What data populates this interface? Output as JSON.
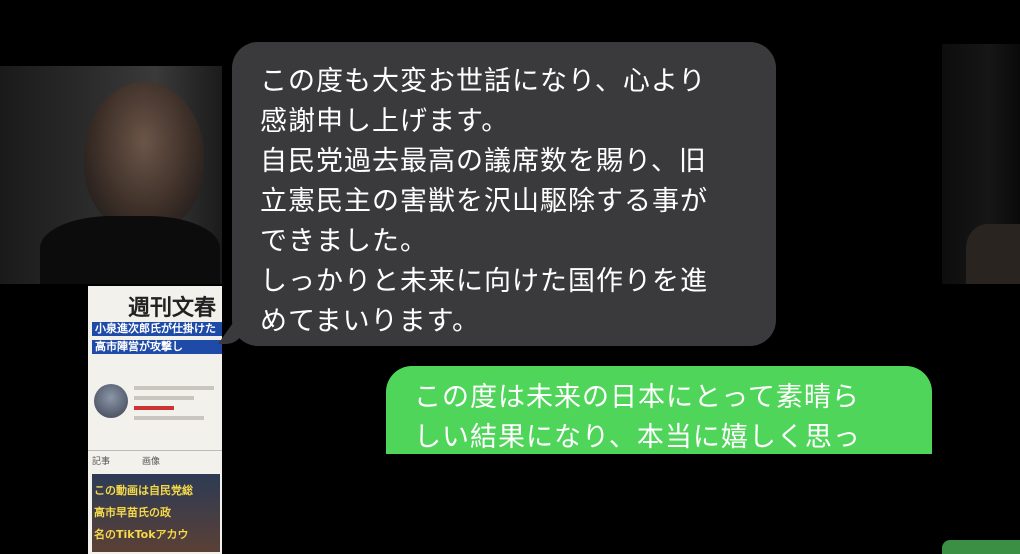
{
  "magazine": {
    "title": "週刊文春",
    "headlines": [
      "小泉進次郎氏が仕掛けた",
      "高市陣営が攻撃し"
    ],
    "tabs": [
      "記事",
      "画像"
    ],
    "thumb_lines": [
      "この動画は自民党総",
      "高市早苗氏の政",
      "名のTikTokアカウ"
    ]
  },
  "chat": {
    "incoming": {
      "lines": [
        "この度も大変お世話になり、心より",
        "感謝申し上げます。",
        "自民党過去最高の議席数を賜り、旧",
        "立憲民主の害獣を沢山駆除する事が",
        "できました。",
        "しっかりと未来に向けた国作りを進",
        "めてまいります。"
      ],
      "bubble_color": "#3a3a3c"
    },
    "outgoing": {
      "lines": [
        "この度は未来の日本にとって素晴ら",
        "しい結果になり、本当に嬉しく思っ"
      ],
      "bubble_color": "#4fd65a"
    }
  }
}
